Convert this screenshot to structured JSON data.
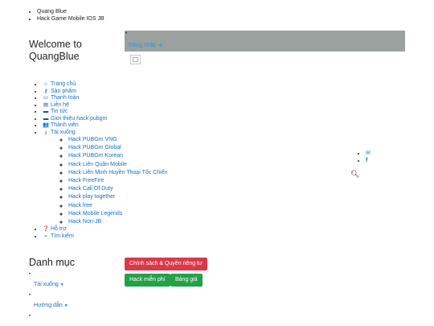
{
  "top_links": [
    "Quang Blue",
    "Hack Game Mobile IOS JB"
  ],
  "welcome": {
    "line1": "Welcome to",
    "line2": "QuangBlue"
  },
  "login": {
    "label": "Đăng nhập"
  },
  "nav": {
    "items": [
      {
        "label": "Trang chủ",
        "icon": "home-icon"
      },
      {
        "label": "Sản phẩm",
        "icon": "key-icon"
      },
      {
        "label": "Thanh toán",
        "icon": "credit-card-icon"
      },
      {
        "label": "Liên hệ",
        "icon": "address-card-icon"
      },
      {
        "label": "Tin tức",
        "icon": "news-icon"
      },
      {
        "label": "Giới thiệu hack pubgm",
        "icon": "intro-icon"
      },
      {
        "label": "Thành viên",
        "icon": "users-icon"
      },
      {
        "label": "Tải xuống",
        "icon": "download-icon"
      },
      {
        "label": "Hỗ trợ",
        "icon": "question-icon"
      },
      {
        "label": "Tìm kiếm",
        "icon": "search-icon"
      }
    ],
    "download_sub": [
      "Hack PUBGm VNG",
      "Hack PUBGm Global",
      "Hack PUBGm Korean",
      "Hack Liên Quân Mobile",
      "Hack Liên Minh Huyền Thoại Tốc Chiến",
      "Hack FreeFire",
      "Hack Call Of Duty",
      "Hack play together",
      "Hack free",
      "Hack Mobile Legends",
      "Hack Non-JB"
    ]
  },
  "categories": {
    "title": "Danh mục",
    "items": [
      "Tải xuống",
      "Hướng dẫn"
    ]
  },
  "buttons": {
    "policy": "Chính sách & Quyền riêng tư",
    "hack_free": "Hack miễn phí",
    "price": "Bảng giá"
  },
  "colors": {
    "link": "#1a6fc4",
    "loginbar": "#9ba19f",
    "red_button": "#d9394a",
    "green_button": "#24a048"
  }
}
